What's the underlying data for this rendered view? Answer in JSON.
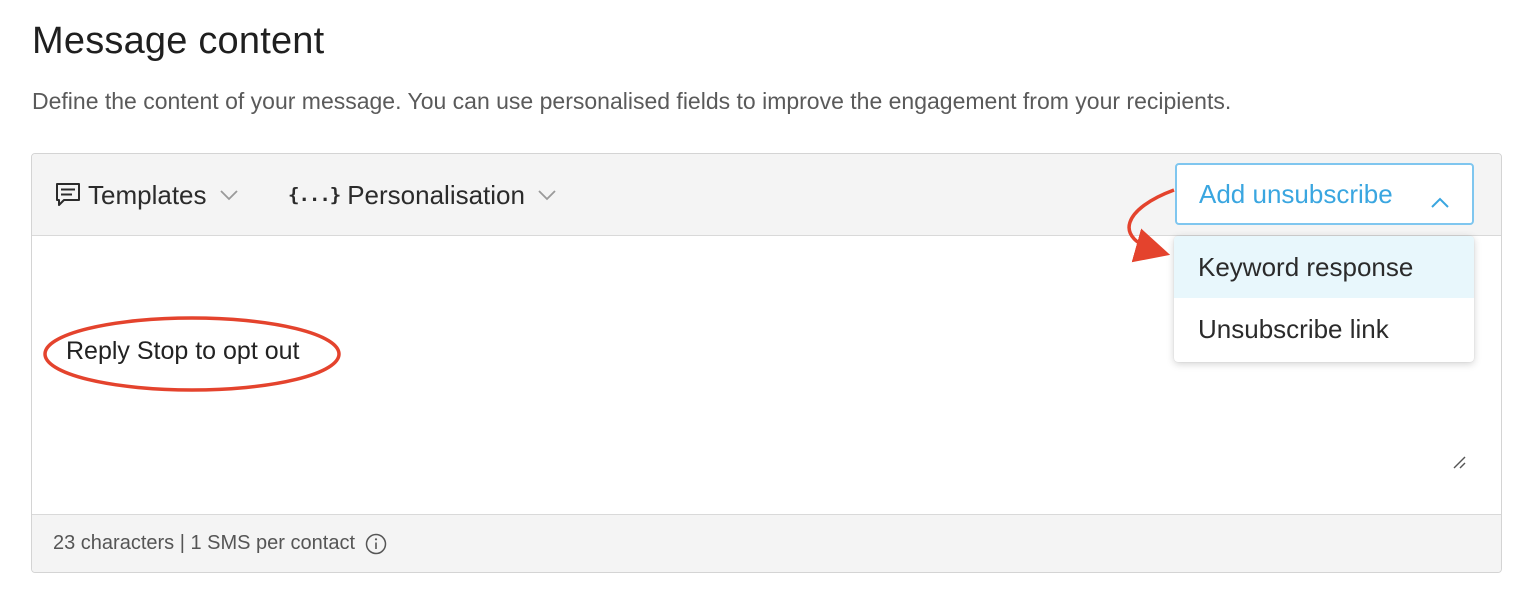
{
  "header": {
    "title": "Message content",
    "description": "Define the content of your message. You can use personalised fields to improve the engagement from your recipients."
  },
  "toolbar": {
    "templates_label": "Templates",
    "personalisation_icon_text": "{...}",
    "personalisation_label": "Personalisation",
    "add_unsubscribe_label": "Add unsubscribe"
  },
  "dropdown": {
    "items": [
      {
        "label": "Keyword response",
        "highlighted": true
      },
      {
        "label": "Unsubscribe link",
        "highlighted": false
      }
    ]
  },
  "editor": {
    "message_text": "Reply Stop to opt out"
  },
  "footer": {
    "counter_text": "23 characters | 1 SMS per contact"
  },
  "icons": {
    "templates": "message-lines-icon",
    "personalisation": "braces-icon",
    "chevron": "chevron-down-icon",
    "dropdown_open": "chevron-up-icon",
    "info": "info-circle-icon",
    "resize": "resize-handle-icon"
  },
  "colors": {
    "accent_blue": "#3aa6e0",
    "accent_border": "#7fc6ef",
    "highlight_bg": "#e8f7fc",
    "annotation_red": "#e4432d",
    "toolbar_bg": "#f4f4f4"
  }
}
